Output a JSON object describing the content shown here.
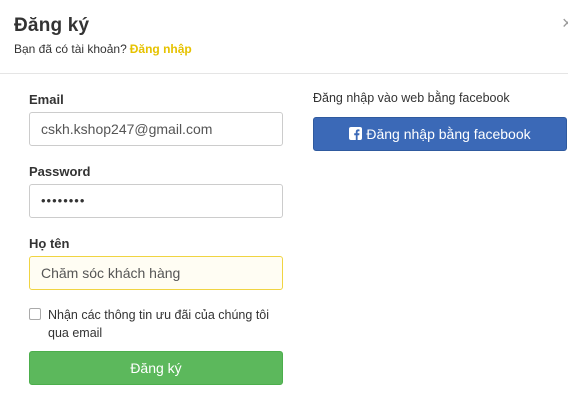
{
  "header": {
    "title": "Đăng ký",
    "subtitle": "Bạn đã có tài khoản?",
    "login_link": "Đăng nhập",
    "close": "×"
  },
  "form": {
    "email": {
      "label": "Email",
      "value": "cskh.kshop247@gmail.com"
    },
    "password": {
      "label": "Password",
      "value": "••••••••"
    },
    "fullname": {
      "label": "Họ tên",
      "value": "Chăm sóc khách hàng"
    },
    "newsletter": {
      "label": "Nhận các thông tin ưu đãi của chúng tôi qua email",
      "checked": false
    },
    "submit_label": "Đăng ký"
  },
  "facebook": {
    "caption": "Đăng nhập vào web bằng facebook",
    "button_label": "Đăng nhập bằng facebook",
    "icon": "facebook-icon"
  },
  "colors": {
    "submit": "#5cb85c",
    "facebook": "#3b69b7",
    "link": "#e6c200",
    "focused_border": "#f0d442"
  }
}
